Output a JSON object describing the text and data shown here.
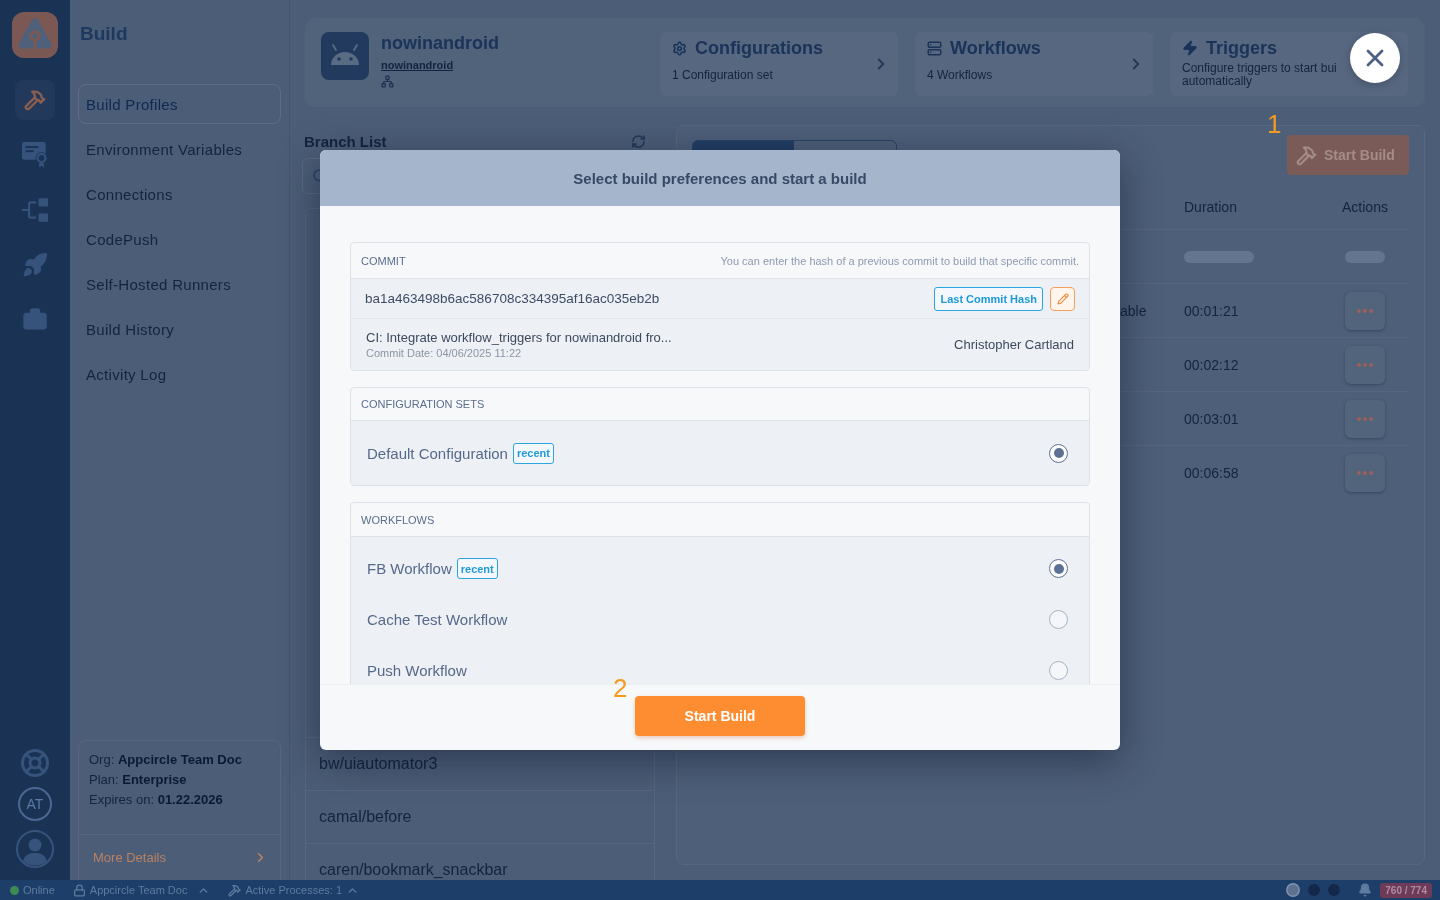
{
  "rail": {
    "items": [
      {
        "selected": true
      },
      {
        "selected": false
      },
      {
        "selected": false
      },
      {
        "selected": false
      },
      {
        "selected": false
      }
    ],
    "avatar": "AT"
  },
  "sidebar": {
    "title": "Build",
    "items": [
      {
        "label": "Build Profiles",
        "selected": true
      },
      {
        "label": "Environment Variables",
        "selected": false
      },
      {
        "label": "Connections",
        "selected": false
      },
      {
        "label": "CodePush",
        "selected": false
      },
      {
        "label": "Self-Hosted Runners",
        "selected": false
      },
      {
        "label": "Build History",
        "selected": false
      },
      {
        "label": "Activity Log",
        "selected": false
      }
    ],
    "org_card": {
      "lines": [
        "Org: **Appcircle Team Doc**",
        "Plan: **Enterprise**",
        "Expires on: **01.22.2026**"
      ],
      "link": "More Details"
    }
  },
  "header": {
    "app_name": "nowinandroid",
    "repo_link": "nowinandroid",
    "cards": [
      {
        "title": "Configurations",
        "lines": [
          "1 Configuration set"
        ]
      },
      {
        "title": "Workflows",
        "lines": [
          "4 Workflows"
        ]
      },
      {
        "title": "Triggers",
        "lines": [
          "Configure triggers to start bui",
          "automatically"
        ]
      }
    ]
  },
  "branch_list": {
    "title": "Branch List",
    "branches": [
      {
        "name": "bw/uiautomator3"
      },
      {
        "name": "camal/before"
      },
      {
        "name": "caren/bookmark_snackbar"
      }
    ]
  },
  "builds": {
    "annotation": "1",
    "start_button": "Start Build",
    "columns": [
      {
        "label": "Duration"
      },
      {
        "label": "Actions"
      }
    ],
    "rows": [
      {
        "kind": "skeleton"
      },
      {
        "kind": "build",
        "column_1": "able",
        "duration": "00:01:21"
      },
      {
        "kind": "build",
        "duration": "00:02:12"
      },
      {
        "kind": "build",
        "duration": "00:03:01"
      },
      {
        "kind": "build",
        "duration": "00:06:58"
      }
    ]
  },
  "modal": {
    "title": "Select build preferences and start a build",
    "commit": {
      "heading": "COMMIT",
      "hint": "You can enter the hash of a previous commit to build that specific commit.",
      "hash": "ba1a463498b6ac586708c334395af16ac035eb2b",
      "last_commit_button": "Last Commit Hash",
      "message": "CI: Integrate workflow_triggers for nowinandroid fro...",
      "date": "Commit Date: 04/06/2025 11:22",
      "author": "Christopher Cartland"
    },
    "configuration_sets": {
      "heading": "CONFIGURATION SETS",
      "options": [
        {
          "name": "Default Configuration",
          "badge": "recent",
          "selected": true
        }
      ]
    },
    "workflows": {
      "heading": "WORKFLOWS",
      "options": [
        {
          "name": "FB Workflow",
          "badge": "recent",
          "selected": true
        },
        {
          "name": "Cache Test Workflow",
          "selected": false
        },
        {
          "name": "Push Workflow",
          "selected": false
        }
      ]
    },
    "annotation": "2",
    "start_button": "Start Build"
  },
  "status_bar": {
    "connection": "Online",
    "organization": "Appcircle Team Doc",
    "processes": "Active Processes: 1",
    "usage": "760 / 774"
  }
}
